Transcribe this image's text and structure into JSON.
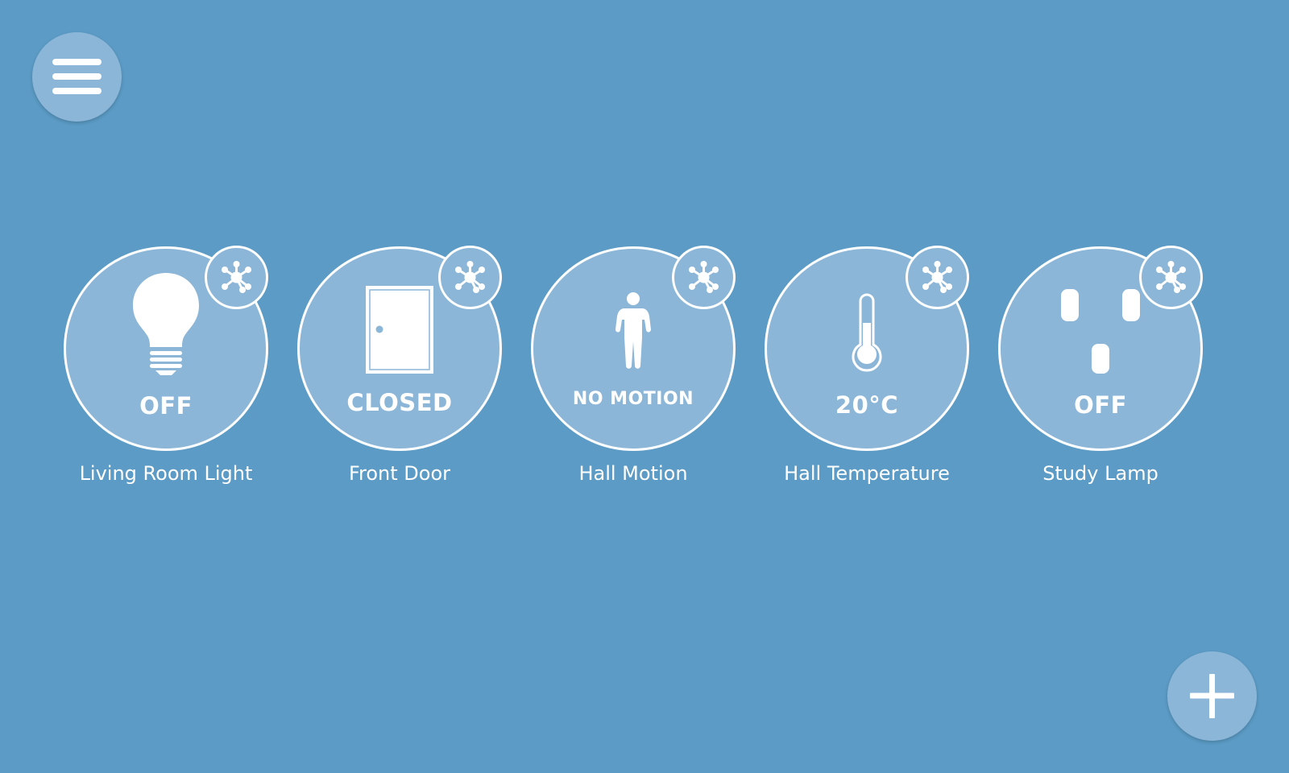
{
  "theme": {
    "background": "#5b9bc5",
    "tile": "#8bb6d8",
    "foreground": "#ffffff"
  },
  "menu_button": {
    "icon": "hamburger-menu-icon"
  },
  "add_button": {
    "icon": "plus-icon"
  },
  "devices": [
    {
      "name": "Living Room Light",
      "state": "OFF",
      "icon": "lightbulb-icon",
      "badge_icon": "zwave-network-icon"
    },
    {
      "name": "Front Door",
      "state": "CLOSED",
      "icon": "door-icon",
      "badge_icon": "zwave-network-icon"
    },
    {
      "name": "Hall Motion",
      "state": "NO MOTION",
      "icon": "person-icon",
      "badge_icon": "zwave-network-icon"
    },
    {
      "name": "Hall Temperature",
      "state": "20°C",
      "icon": "thermometer-icon",
      "badge_icon": "zwave-network-icon"
    },
    {
      "name": "Study Lamp",
      "state": "OFF",
      "icon": "power-outlet-icon",
      "badge_icon": "zwave-network-icon"
    }
  ]
}
